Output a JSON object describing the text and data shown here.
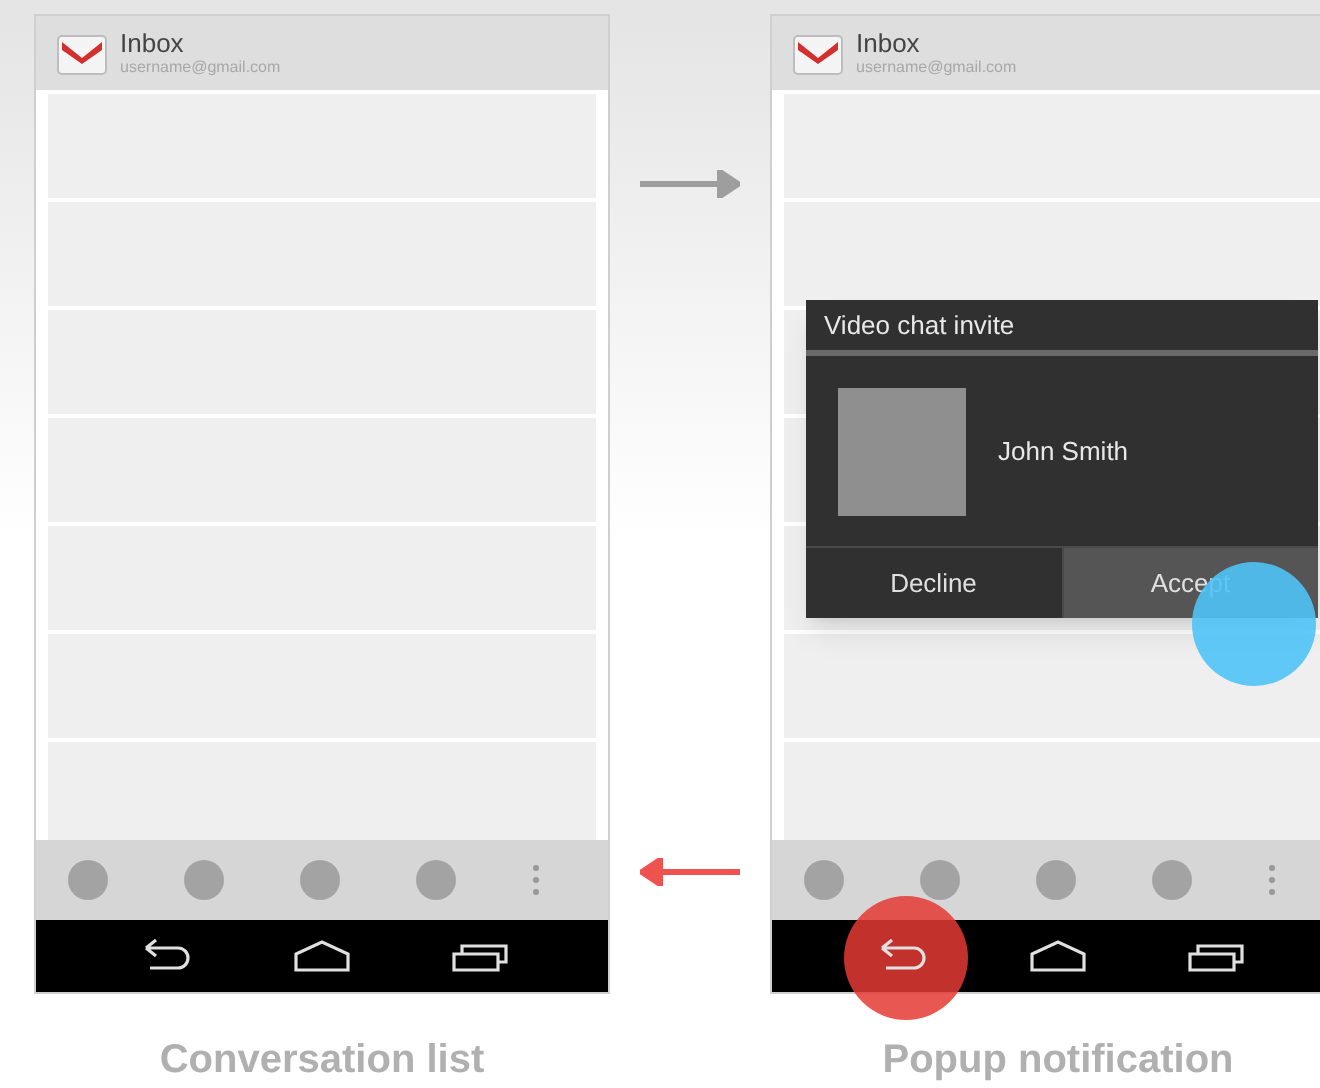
{
  "phones": [
    {
      "header": {
        "title": "Inbox",
        "account": "username@gmail.com"
      },
      "back_pressed": false,
      "caption": "Conversation list"
    },
    {
      "header": {
        "title": "Inbox",
        "account": "username@gmail.com"
      },
      "back_pressed": true,
      "caption": "Popup notification",
      "popup": {
        "title": "Video chat invite",
        "contact": "John Smith",
        "buttons": [
          {
            "label": "Decline",
            "selected": false
          },
          {
            "label": "Accept",
            "selected": true
          }
        ]
      }
    }
  ],
  "arrows": [
    {
      "kind": "forward",
      "color": "#9e9e9e"
    },
    {
      "kind": "back",
      "color": "#ef5350"
    }
  ]
}
